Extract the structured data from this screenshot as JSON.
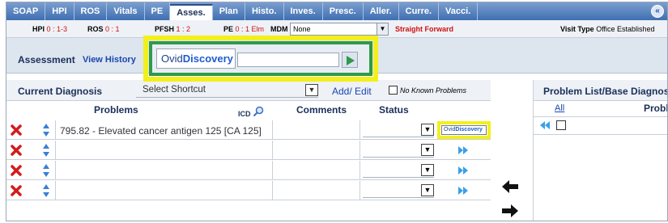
{
  "tabs": [
    {
      "label": "SOAP",
      "active": false
    },
    {
      "label": "HPI",
      "active": false
    },
    {
      "label": "ROS",
      "active": false
    },
    {
      "label": "Vitals",
      "active": false
    },
    {
      "label": "PE",
      "active": false
    },
    {
      "label": "Asses.",
      "active": true
    },
    {
      "label": "Plan",
      "active": false
    },
    {
      "label": "Histo.",
      "active": false
    },
    {
      "label": "Inves.",
      "active": false
    },
    {
      "label": "Presc.",
      "active": false
    },
    {
      "label": "Aller.",
      "active": false
    },
    {
      "label": "Curre.",
      "active": false
    },
    {
      "label": "Vacci.",
      "active": false
    }
  ],
  "collapse_label": "«",
  "scores": {
    "hpi_label": "HPI",
    "hpi_value": "0 : 1-3",
    "ros_label": "ROS",
    "ros_value": "0 : 1",
    "pfsh_label": "PFSH",
    "pfsh_value": "1 : 2",
    "pe_label": "PE",
    "pe_value": "0 : 1 Elm",
    "mdm_label": "MDM",
    "mdm_value": "None",
    "straight_forward": "Straight Forward",
    "visit_type_label": "Visit Type",
    "visit_type_value": "Office Established"
  },
  "assessment": {
    "title": "Assessment",
    "view_history": "View History"
  },
  "ovid": {
    "brand_part1": "Ovid",
    "brand_part2": "Discovery",
    "search_value": ""
  },
  "diagnosis": {
    "title": "Current Diagnosis",
    "shortcut_value": "Select Shortcut",
    "add_edit": "Add/ Edit",
    "no_known_problems": "No Known Problems",
    "col_problems": "Problems",
    "col_icd": "ICD",
    "col_comments": "Comments",
    "col_status": "Status",
    "rows": [
      {
        "problem": "795.82 - Elevated cancer antigen 125 [CA 125]",
        "comment": "",
        "status": "",
        "has_ovid": true
      },
      {
        "problem": "",
        "comment": "",
        "status": "",
        "has_ovid": false
      },
      {
        "problem": "",
        "comment": "",
        "status": "",
        "has_ovid": false
      },
      {
        "problem": "",
        "comment": "",
        "status": "",
        "has_ovid": false
      }
    ]
  },
  "problem_list": {
    "title": "Problem List/Base Diagnos",
    "all_link": "All",
    "col_problem": "Probl"
  },
  "colors": {
    "tab_bar": "#3f6fb0",
    "highlight_yellow": "#f3ef1d",
    "highlight_green": "#2e9a4a",
    "alert_red": "#d01010",
    "link_blue": "#1a46b0"
  }
}
